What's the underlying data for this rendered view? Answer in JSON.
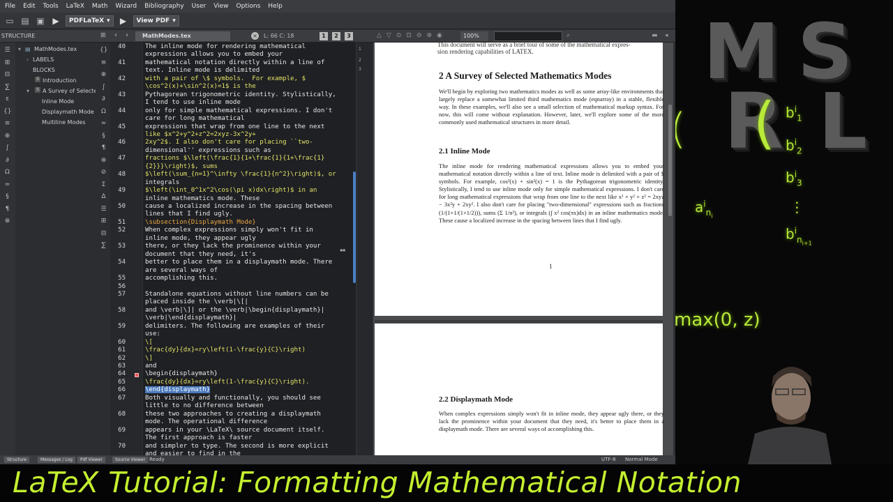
{
  "menu": [
    "File",
    "Edit",
    "Tools",
    "LaTeX",
    "Math",
    "Wizard",
    "Bibliography",
    "User",
    "View",
    "Options",
    "Help"
  ],
  "toolbar": {
    "compiler": "PDFLaTeX",
    "viewer": "View PDF"
  },
  "structure": {
    "title": "STRUCTURE",
    "items": [
      {
        "label": "MathModes.tex"
      },
      {
        "label": "LABELS"
      },
      {
        "label": "BLOCKS"
      },
      {
        "label": "Introduction"
      },
      {
        "label": "A Survey of Selected"
      },
      {
        "label": "Inline Mode"
      },
      {
        "label": "Displaymath Mode"
      },
      {
        "label": "Multiline Modes"
      }
    ]
  },
  "editor": {
    "filename": "MathModes.tex",
    "cursor": "L: 66 C: 18",
    "views": [
      "1",
      "2",
      "3"
    ],
    "minimap": [
      "1",
      "2",
      "3"
    ],
    "lines": [
      {
        "n": "40",
        "t": "The inline mode for rendering mathematical"
      },
      {
        "n": "",
        "t": "expressions allows you to embed your"
      },
      {
        "n": "41",
        "t": "mathematical notation directly within a line of"
      },
      {
        "n": "",
        "t": "text. Inline mode is delimited"
      },
      {
        "n": "42",
        "t": "with a pair of \\$ symbols.  For example, $"
      },
      {
        "n": "",
        "t": "\\cos^2(x)+\\sin^2(x)=1$ is the"
      },
      {
        "n": "43",
        "t": "Pythagorean trigonometric identity. Stylistically,"
      },
      {
        "n": "",
        "t": "I tend to use inline mode"
      },
      {
        "n": "44",
        "t": "only for simple mathematical expressions. I don't"
      },
      {
        "n": "",
        "t": "care for long mathematical"
      },
      {
        "n": "45",
        "t": "expressions that wrap from one line to the next"
      },
      {
        "n": "",
        "t": "like $x^2+y^2+z^2=2xyz-3x^2y+"
      },
      {
        "n": "46",
        "t": "2xy^2$. I also don't care for placing ``two-"
      },
      {
        "n": "",
        "t": "dimensional'' expressions such as"
      },
      {
        "n": "47",
        "t": "fractions $\\left(\\frac{1}{1+\\frac{1}{1+\\frac{1}"
      },
      {
        "n": "",
        "t": "{2}}}\\right)$, sums"
      },
      {
        "n": "48",
        "t": "$\\left(\\sum_{n=1}^\\infty \\frac{1}{n^2}\\right)$, or"
      },
      {
        "n": "",
        "t": "integrals"
      },
      {
        "n": "49",
        "t": "$\\left(\\int_0^1x^2\\cos(\\pi x)dx\\right)$ in an"
      },
      {
        "n": "",
        "t": "inline mathematics mode. These"
      },
      {
        "n": "50",
        "t": "cause a localized increase in the spacing between"
      },
      {
        "n": "",
        "t": "lines that I find ugly."
      },
      {
        "n": "51",
        "t": "\\subsection{Displaymath Mode}"
      },
      {
        "n": "52",
        "t": "When complex expressions simply won't fit in"
      },
      {
        "n": "",
        "t": "inline mode, they appear ugly"
      },
      {
        "n": "53",
        "t": "there, or they lack the prominence within your"
      },
      {
        "n": "",
        "t": "document that they need, it's"
      },
      {
        "n": "54",
        "t": "better to place them in a displaymath mode. There"
      },
      {
        "n": "",
        "t": "are several ways of"
      },
      {
        "n": "55",
        "t": "accomplishing this."
      },
      {
        "n": "56",
        "t": ""
      },
      {
        "n": "57",
        "t": "Standalone equations without line numbers can be"
      },
      {
        "n": "",
        "t": "placed inside the \\verb|\\[|"
      },
      {
        "n": "58",
        "t": "and \\verb|\\]| or the \\verb|\\begin{displaymath}|"
      },
      {
        "n": "",
        "t": "\\verb|\\end{displaymath}|"
      },
      {
        "n": "59",
        "t": "delimiters. The following are examples of their"
      },
      {
        "n": "",
        "t": "use:"
      },
      {
        "n": "60",
        "t": "\\["
      },
      {
        "n": "61",
        "t": "\\frac{dy}{dx}=ry\\left(1-\\frac{y}{C}\\right)"
      },
      {
        "n": "62",
        "t": "\\]"
      },
      {
        "n": "63",
        "t": "and"
      },
      {
        "n": "64",
        "t": "\\begin{displaymath}"
      },
      {
        "n": "65",
        "t": "\\frac{dy}{dx}=ry\\left(1-\\frac{y}{C}\\right)."
      },
      {
        "n": "66",
        "t": "\\end{displaymath}"
      },
      {
        "n": "67",
        "t": "Both visually and functionally, you should see"
      },
      {
        "n": "",
        "t": "little to no difference between"
      },
      {
        "n": "68",
        "t": "these two approaches to creating a displaymath"
      },
      {
        "n": "",
        "t": "mode. The operational difference"
      },
      {
        "n": "69",
        "t": "appears in your \\LaTeX\\ source document itself."
      },
      {
        "n": "",
        "t": "The first approach is faster"
      },
      {
        "n": "70",
        "t": "and simpler to type. The second is more explicit"
      },
      {
        "n": "",
        "t": "and easier to find in the"
      }
    ]
  },
  "pdf": {
    "zoom": "100%",
    "intro": "This document will serve as a brief tour of some of the mathematical expres-\nsion rendering capabilities of LATEX.",
    "section_title": "2   A Survey of Selected Mathematics Modes",
    "section_para": "We'll begin by exploring two mathematics modes as well as some array-like environments that largely replace a somewhat limited third mathematics mode (eqnarray) in a stable, flexible way. In these examples, we'll also see a small selection of mathematical markup syntax. For now, this will come without explanation. However, later, we'll explore some of the more commonly used mathematical structures in more detail.",
    "sub1_title": "2.1   Inline Mode",
    "sub1_para": "The inline mode for rendering mathematical expressions allows you to embed your mathematical notation directly within a line of text. Inline mode is delimited with a pair of $ symbols. For example, cos²(x) + sin²(x) = 1 is the Pythagorean trigonometric identity. Stylistically, I tend to use inline mode only for simple mathematical expressions. I don't care for long mathematical expressions that wrap from one line to the next like x² + y² + z² = 2xyz − 3x²y + 2xy². I also don't care for placing \"two-dimensional\" expressions such as fractions (1/(1+1/(1+1/2))), sums (Σ 1/n²), or integrals (∫ x² cos(πx)dx) in an inline mathematics mode. These cause a localized increase in the spacing between lines that I find ugly.",
    "page_number": "1",
    "sub2_title": "2.2   Displaymath Mode",
    "sub2_para": "When complex expressions simply won't fit in inline mode, they appear ugly there, or they lack the prominence within your document that they need, it's better to place them in a displaymath mode. There are several ways of accomplishing this."
  },
  "statusbar": {
    "tabs": [
      "Structure",
      "Messages / Log",
      "Pdf Viewer",
      "Source Viewer"
    ],
    "ready": "Ready",
    "encoding": "UTF-8",
    "mode": "Normal Mode"
  },
  "overlay": {
    "big_letters": [
      "M",
      "S",
      "R",
      "L"
    ],
    "max_text": "max(0, z)"
  },
  "banner": "LaTeX Tutorial: Formatting Mathematical Notation",
  "colors": {
    "accent_green": "#c4ef2f",
    "selection": "#4b7bbd",
    "command": "#e8a545"
  }
}
